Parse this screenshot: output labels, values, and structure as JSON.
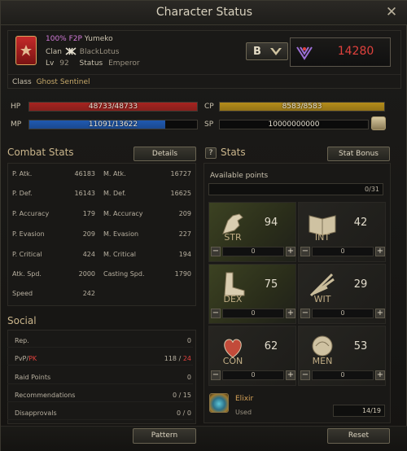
{
  "window": {
    "title": "Character Status"
  },
  "character": {
    "f2p": "100% F2P",
    "name": "Yumeko",
    "clan_label": "Clan",
    "clan": "BlackLotus",
    "level_label": "Lv",
    "level": "92",
    "status_label": "Status",
    "status": "Emperor",
    "grade_letter": "B",
    "power": "14280",
    "class_label": "Class",
    "class_name": "Ghost Sentinel"
  },
  "bars": {
    "hp": {
      "label": "HP",
      "text": "48733/48733",
      "fill": 1.0,
      "color": "#a62420"
    },
    "mp": {
      "label": "MP",
      "text": "11091/13622",
      "fill": 0.81,
      "color": "#1f59b0"
    },
    "cp": {
      "label": "CP",
      "text": "8583/8583",
      "fill": 1.0,
      "color": "#b58d1a"
    },
    "sp": {
      "label": "SP",
      "text": "10000000000",
      "fill": 0,
      "color": "#000000"
    }
  },
  "combat": {
    "title": "Combat Stats",
    "details_button": "Details",
    "left": [
      {
        "name": "P. Atk.",
        "value": "46183"
      },
      {
        "name": "P. Def.",
        "value": "16143"
      },
      {
        "name": "P. Accuracy",
        "value": "179"
      },
      {
        "name": "P. Evasion",
        "value": "209"
      },
      {
        "name": "P. Critical",
        "value": "424"
      },
      {
        "name": "Atk. Spd.",
        "value": "2000"
      },
      {
        "name": "Speed",
        "value": "242"
      }
    ],
    "right": [
      {
        "name": "M. Atk.",
        "value": "16727"
      },
      {
        "name": "M. Def.",
        "value": "16625"
      },
      {
        "name": "M. Accuracy",
        "value": "209"
      },
      {
        "name": "M. Evasion",
        "value": "227"
      },
      {
        "name": "M. Critical",
        "value": "194"
      },
      {
        "name": "Casting Spd.",
        "value": "1790"
      }
    ]
  },
  "social": {
    "title": "Social",
    "rep_label": "Rep.",
    "rep_value": "0",
    "pvp_label": "PvP",
    "pvp_sep": "/",
    "pk_label": "PK",
    "pvp_value": "118",
    "pvp_value_sep": " / ",
    "pk_value": "24",
    "raid_label": "Raid Points",
    "raid_value": "0",
    "rec_label": "Recommendations",
    "rec_value": "0 / 15",
    "dis_label": "Disapprovals",
    "dis_value": "0 / 0"
  },
  "stats": {
    "help_icon": "?",
    "title": "Stats",
    "bonus_button": "Stat Bonus",
    "available_label": "Available points",
    "available_value": "0/31",
    "items": [
      {
        "name": "STR",
        "value": "94",
        "alloc": "0",
        "icon": "arm-icon",
        "active": true
      },
      {
        "name": "INT",
        "value": "42",
        "alloc": "0",
        "icon": "book-icon",
        "active": false
      },
      {
        "name": "DEX",
        "value": "75",
        "alloc": "0",
        "icon": "foot-icon",
        "active": true
      },
      {
        "name": "WIT",
        "value": "29",
        "alloc": "0",
        "icon": "quill-icon",
        "active": false
      },
      {
        "name": "CON",
        "value": "62",
        "alloc": "0",
        "icon": "heart-icon",
        "active": false
      },
      {
        "name": "MEN",
        "value": "53",
        "alloc": "0",
        "icon": "head-icon",
        "active": false
      }
    ],
    "minus": "−",
    "plus": "+"
  },
  "elixir": {
    "name": "Elixir",
    "used_label": "Used",
    "value": "14/19"
  },
  "buttons": {
    "pattern": "Pattern",
    "reset": "Reset"
  }
}
